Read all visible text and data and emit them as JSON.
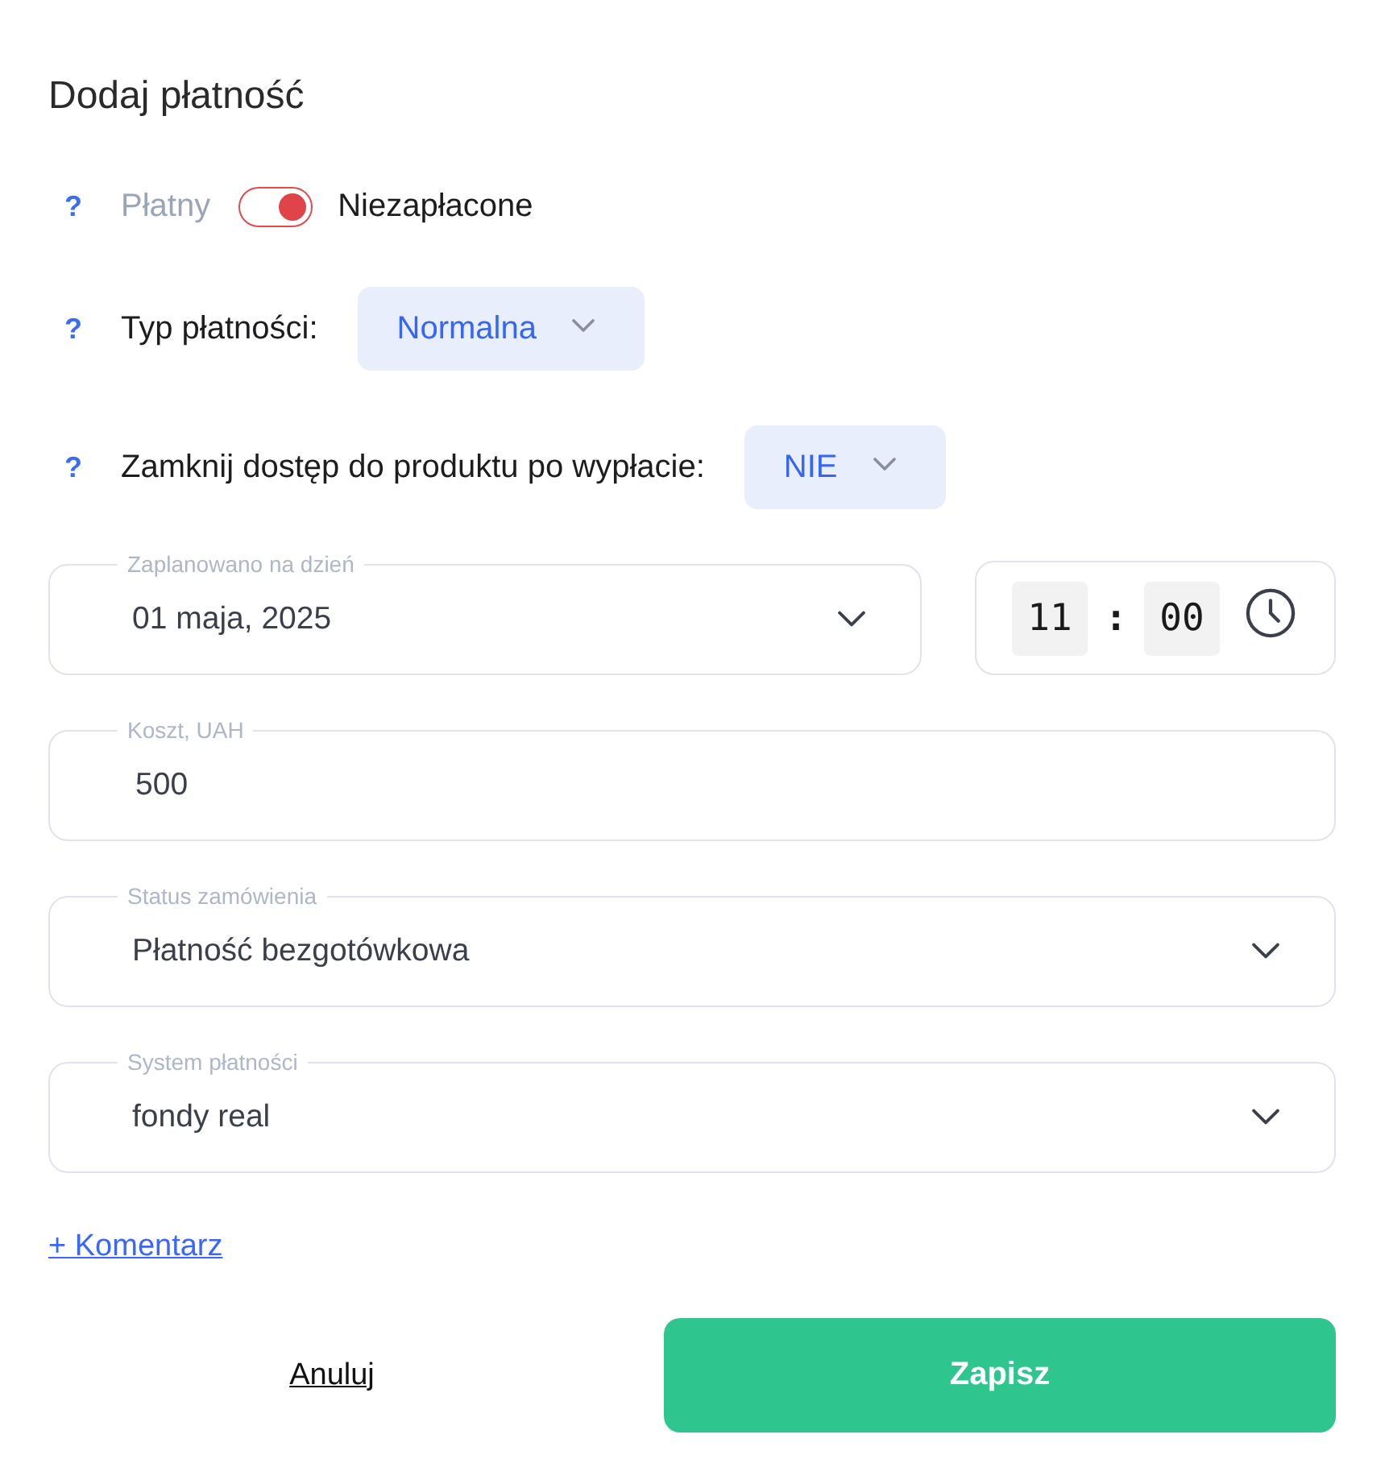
{
  "title": "Dodaj płatność",
  "settings": [
    {
      "kind": "switch",
      "help": "?",
      "options": [
        {
          "label": "Płatny",
          "selected": false
        },
        {
          "label": "Niezapłacone",
          "selected": true
        }
      ]
    },
    {
      "kind": "select",
      "help": "?",
      "label": "Typ płatności:",
      "value": "Normalna"
    },
    {
      "kind": "select",
      "help": "?",
      "label": "Zamknij dostęp do produktu po wypłacie:",
      "value": "NIE"
    }
  ],
  "schedule": {
    "date": {
      "label": "Zaplanowano na dzień",
      "value": "01 maja, 2025"
    },
    "time": {
      "hours": "11",
      "separator": ":",
      "minutes": "00"
    }
  },
  "fields": [
    {
      "kind": "input",
      "label": "Koszt, UAH",
      "value": "500"
    },
    {
      "kind": "select",
      "label": "Status zamówienia",
      "value": "Płatność bezgotówkowa"
    },
    {
      "kind": "select",
      "label": "System płatności",
      "value": "fondy real"
    }
  ],
  "comment_link": "+ Komentarz",
  "buttons": {
    "cancel": "Anuluj",
    "save": "Zapisz"
  }
}
